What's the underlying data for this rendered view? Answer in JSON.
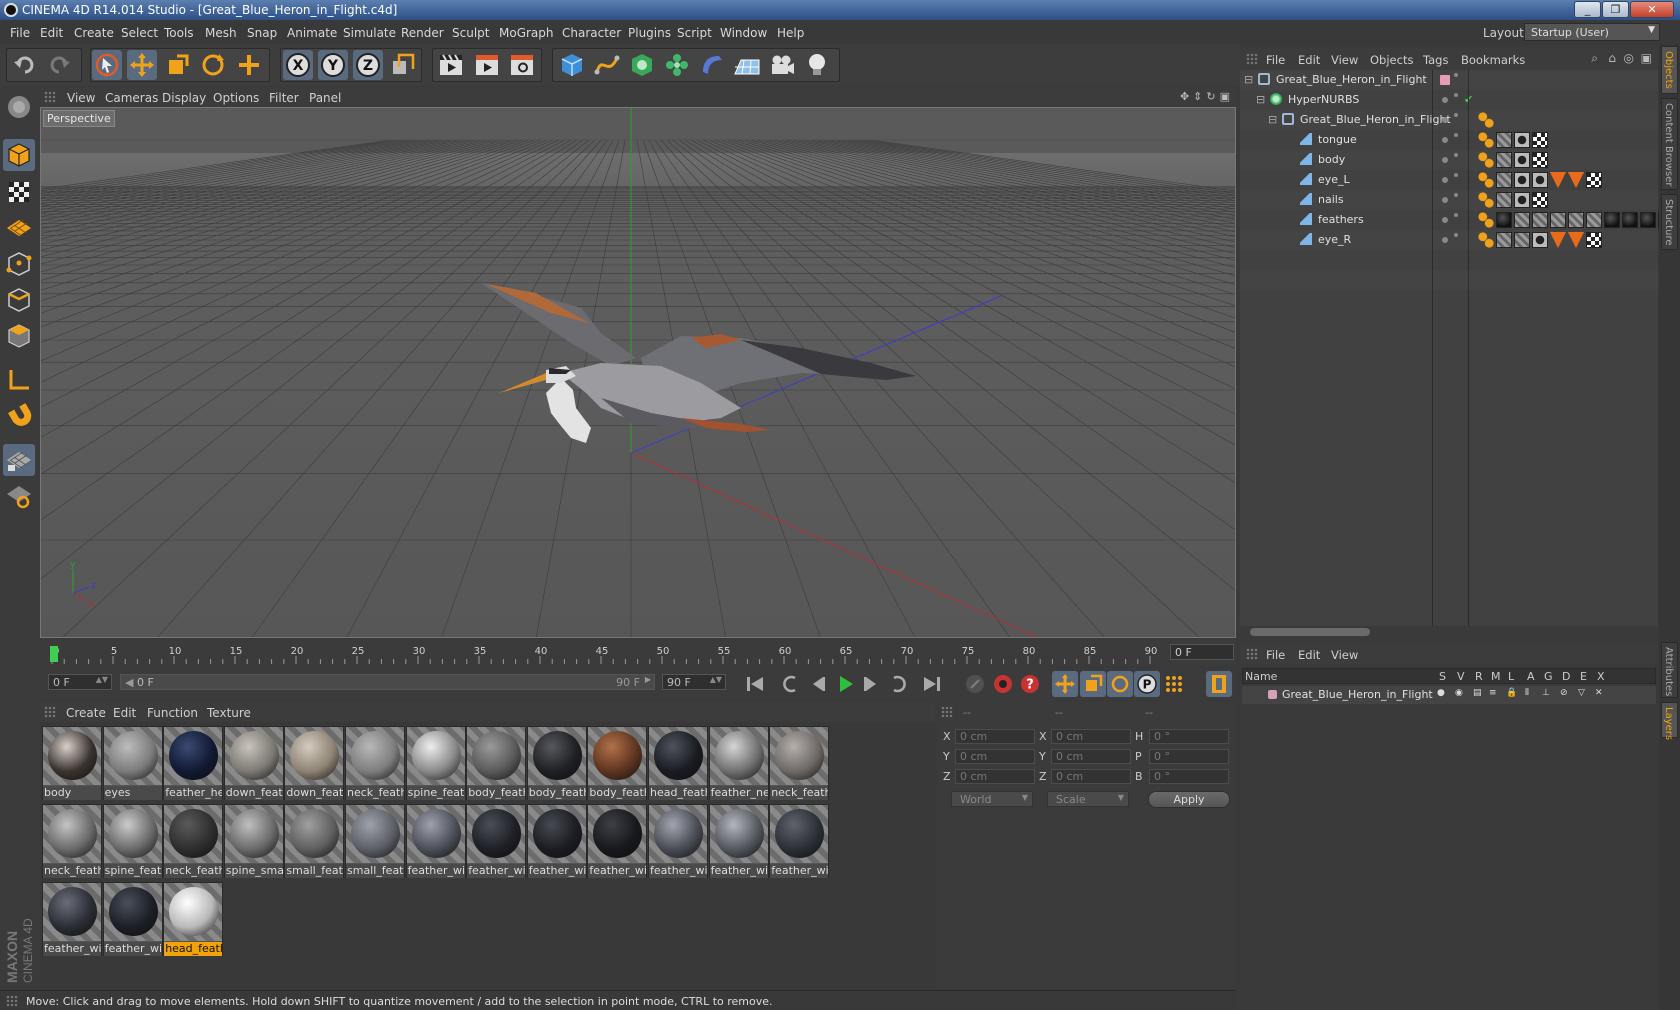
{
  "window": {
    "title": "CINEMA 4D R14.014 Studio - [Great_Blue_Heron_in_Flight.c4d]",
    "controls": [
      "_",
      "❐",
      "✕"
    ]
  },
  "menu": [
    "File",
    "Edit",
    "Create",
    "Select",
    "Tools",
    "Mesh",
    "Snap",
    "Animate",
    "Simulate",
    "Render",
    "Sculpt",
    "MoGraph",
    "Character",
    "Plugins",
    "Script",
    "Window",
    "Help"
  ],
  "layout": {
    "label": "Layout:",
    "value": "Startup (User)"
  },
  "viewport": {
    "menu": [
      "View",
      "Cameras",
      "Display",
      "Options",
      "Filter",
      "Panel"
    ],
    "label": "Perspective",
    "axis_letters": {
      "x": "x",
      "y": "y",
      "z": "z"
    }
  },
  "timeline": {
    "ticks": [
      "0",
      "5",
      "10",
      "15",
      "20",
      "25",
      "30",
      "35",
      "40",
      "45",
      "50",
      "55",
      "60",
      "65",
      "70",
      "75",
      "80",
      "85",
      "90"
    ],
    "current_frame": "0 F",
    "start_field": "0 F",
    "range_start": "0 F",
    "range_end": "90 F",
    "end_field": "90 F"
  },
  "materials": {
    "menu": [
      "Create",
      "Edit",
      "Function",
      "Texture"
    ],
    "items": [
      {
        "name": "body",
        "color": "#3a3330",
        "hl": "#d8d0c8"
      },
      {
        "name": "eyes",
        "color": "#7c7c7c",
        "hl": "#bdbdbd"
      },
      {
        "name": "feather_he",
        "color": "#121a33",
        "hl": "#3b4a72"
      },
      {
        "name": "down_feat",
        "color": "#7d7a74",
        "hl": "#c9c3ba"
      },
      {
        "name": "down_feat",
        "color": "#8e8374",
        "hl": "#d4ccc0"
      },
      {
        "name": "neck_feath",
        "color": "#7e7e7e",
        "hl": "#b8b8b8"
      },
      {
        "name": "spine_feat",
        "color": "#8a8a8a",
        "hl": "#eeeeee"
      },
      {
        "name": "body_feath",
        "color": "#5a5a5a",
        "hl": "#9a9a9a"
      },
      {
        "name": "body_feath",
        "color": "#1f2024",
        "hl": "#55585e"
      },
      {
        "name": "body_feath",
        "color": "#5e3520",
        "hl": "#b2714a"
      },
      {
        "name": "head_feath",
        "color": "#1a1c22",
        "hl": "#4f535c"
      },
      {
        "name": "feather_ne",
        "color": "#707070",
        "hl": "#d6d6d6"
      },
      {
        "name": "neck_feath",
        "color": "#6e6a68",
        "hl": "#b6aeaa"
      },
      {
        "name": "neck_feath",
        "color": "#6a6a6a",
        "hl": "#c4c4c4"
      },
      {
        "name": "spine_feat",
        "color": "#6a6a6a",
        "hl": "#cccccc"
      },
      {
        "name": "neck_feath",
        "color": "#2e2e2e",
        "hl": "#5a5a5a"
      },
      {
        "name": "spine_smal",
        "color": "#6a6a6a",
        "hl": "#c0c0c0"
      },
      {
        "name": "small_feath",
        "color": "#5f5f5f",
        "hl": "#a0a0a0"
      },
      {
        "name": "small_feath",
        "color": "#5c5f66",
        "hl": "#9ea2aa"
      },
      {
        "name": "feather_wi",
        "color": "#4c4e58",
        "hl": "#9fa2ad"
      },
      {
        "name": "feather_wi",
        "color": "#1e2026",
        "hl": "#4b4e57"
      },
      {
        "name": "feather_wi",
        "color": "#1b1d22",
        "hl": "#474a52"
      },
      {
        "name": "feather_wi",
        "color": "#18191d",
        "hl": "#3e4047"
      },
      {
        "name": "feather_wi",
        "color": "#4a4c55",
        "hl": "#a3a6b0"
      },
      {
        "name": "feather_wi",
        "color": "#55575f",
        "hl": "#b4b6bd"
      },
      {
        "name": "feather_wi",
        "color": "#2c2f36",
        "hl": "#5f636c"
      },
      {
        "name": "feather_wi",
        "color": "#2a2d34",
        "hl": "#6a6e78"
      },
      {
        "name": "feather_wi",
        "color": "#1c1f26",
        "hl": "#4a4f5a"
      },
      {
        "name": "head_feath",
        "color": "#b8b8b8",
        "hl": "#ffffff"
      }
    ]
  },
  "coordinates": {
    "headers": [
      "--",
      "--",
      "--"
    ],
    "rows": [
      {
        "a1": "X",
        "v1": "0 cm",
        "a2": "X",
        "v2": "0 cm",
        "a3": "H",
        "v3": "0 °"
      },
      {
        "a1": "Y",
        "v1": "0 cm",
        "a2": "Y",
        "v2": "0 cm",
        "a3": "P",
        "v3": "0 °"
      },
      {
        "a1": "Z",
        "v1": "0 cm",
        "a2": "Z",
        "v2": "0 cm",
        "a3": "B",
        "v3": "0 °"
      }
    ],
    "mode": "World",
    "transform": "Scale",
    "apply": "Apply"
  },
  "status": "Move: Click and drag to move elements. Hold down SHIFT to quantize movement / add to the selection in point mode, CTRL to remove.",
  "object_manager": {
    "menu": [
      "File",
      "Edit",
      "View",
      "Objects",
      "Tags",
      "Bookmarks"
    ],
    "objects": [
      {
        "name": "Great_Blue_Heron_in_Flight",
        "type": "null"
      },
      {
        "name": "HyperNURBS",
        "type": "nurbs"
      },
      {
        "name": "Great_Blue_Heron_in_Flight",
        "type": "null"
      },
      {
        "name": "tongue",
        "type": "poly"
      },
      {
        "name": "body",
        "type": "poly"
      },
      {
        "name": "eye_L",
        "type": "poly"
      },
      {
        "name": "nails",
        "type": "poly"
      },
      {
        "name": "feathers",
        "type": "poly"
      },
      {
        "name": "eye_R",
        "type": "poly"
      }
    ]
  },
  "layer_manager": {
    "menu": [
      "File",
      "Edit",
      "View"
    ],
    "columns": [
      "Name",
      "S",
      "V",
      "R",
      "M",
      "L",
      "A",
      "G",
      "D",
      "E",
      "X"
    ],
    "layers": [
      {
        "name": "Great_Blue_Heron_in_Flight",
        "color": "#d6a0b8"
      }
    ]
  },
  "side_tabs": [
    "Objects",
    "Content Browser",
    "Structure",
    "Attributes",
    "Layers"
  ],
  "brand": {
    "maxon": "MAXON",
    "product": "CINEMA 4D"
  }
}
